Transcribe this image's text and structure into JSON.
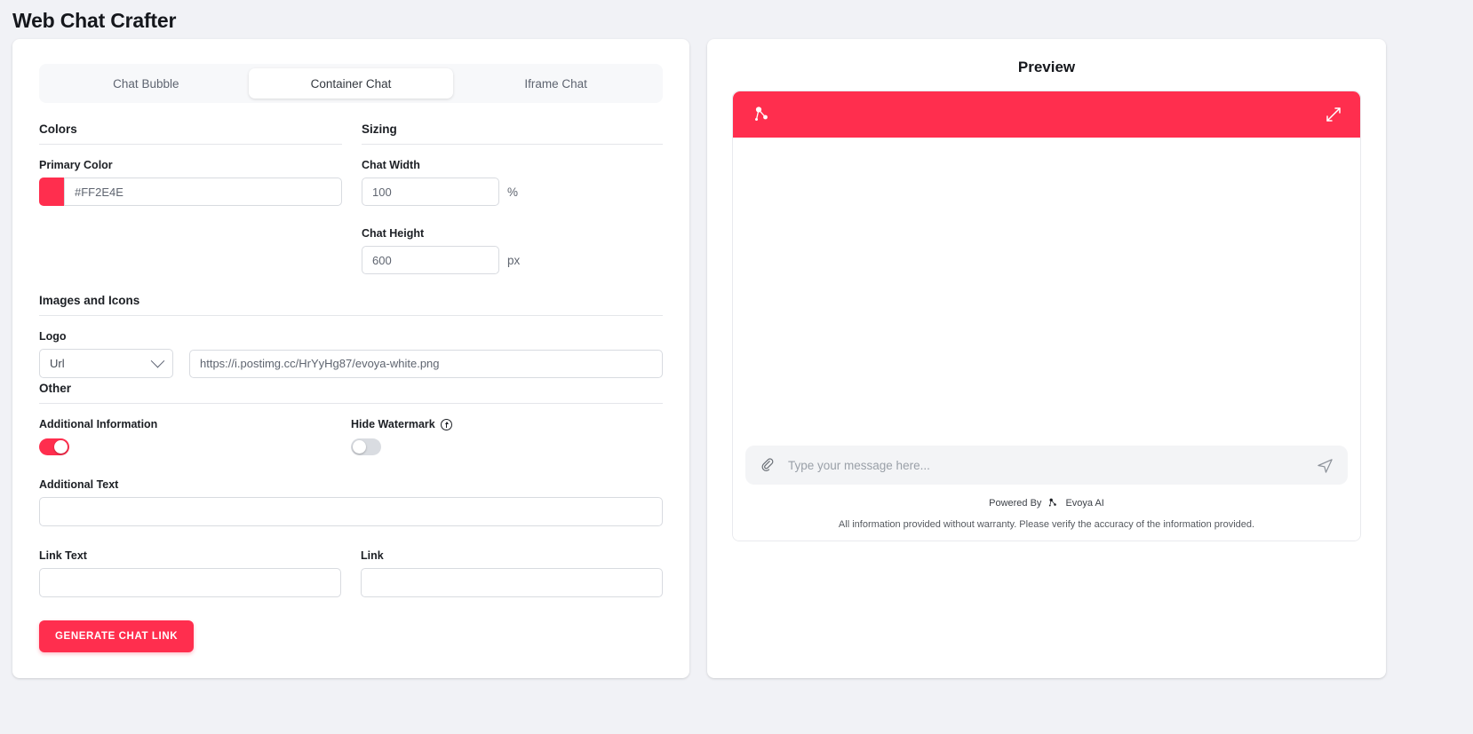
{
  "app": {
    "title": "Web Chat Crafter"
  },
  "tabs": [
    {
      "label": "Chat Bubble",
      "active": false
    },
    {
      "label": "Container Chat",
      "active": true
    },
    {
      "label": "Iframe Chat",
      "active": false
    }
  ],
  "sections": {
    "colors": {
      "heading": "Colors",
      "primary_color": {
        "label": "Primary Color",
        "value": "#FF2E4E",
        "swatch_hex": "#FF2E4E"
      }
    },
    "sizing": {
      "heading": "Sizing",
      "chat_width": {
        "label": "Chat Width",
        "value": "100",
        "unit": "%"
      },
      "chat_height": {
        "label": "Chat Height",
        "value": "600",
        "unit": "px"
      }
    },
    "images_and_icons": {
      "heading": "Images and Icons",
      "logo": {
        "label": "Logo",
        "source_type": "Url",
        "url": "https://i.postimg.cc/HrYyHg87/evoya-white.png"
      }
    },
    "other": {
      "heading": "Other",
      "additional_information": {
        "label": "Additional Information",
        "enabled": true
      },
      "hide_watermark": {
        "label": "Hide Watermark",
        "enabled": false
      },
      "additional_text": {
        "label": "Additional Text",
        "value": ""
      },
      "link_text": {
        "label": "Link Text",
        "value": ""
      },
      "link": {
        "label": "Link",
        "value": ""
      }
    }
  },
  "actions": {
    "generate": "GENERATE CHAT LINK"
  },
  "preview": {
    "title": "Preview",
    "header_color": "#FF2E4E",
    "message_placeholder": "Type your message here...",
    "powered_by": "Powered By",
    "brand": "Evoya AI",
    "disclaimer": "All information provided without warranty. Please verify the accuracy of the information provided."
  }
}
